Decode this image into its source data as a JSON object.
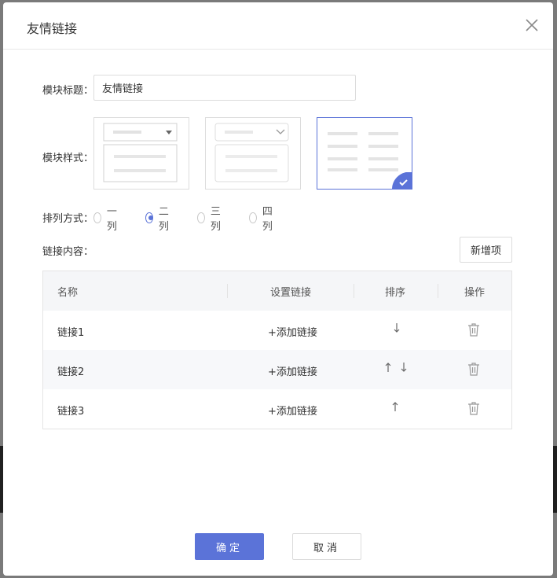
{
  "dialog": {
    "title": "友情链接",
    "close_icon": "close-icon"
  },
  "form": {
    "title_label": "模块标题：",
    "title_value": "友情链接",
    "style_label": "模块样式：",
    "style_options": [
      {
        "name": "dropdown-expanded-style",
        "selected": false
      },
      {
        "name": "dropdown-collapsed-style",
        "selected": false
      },
      {
        "name": "two-column-list-style",
        "selected": true
      }
    ],
    "layout_label": "排列方式：",
    "layout_options": [
      {
        "label": "一列",
        "checked": false
      },
      {
        "label": "二列",
        "checked": true
      },
      {
        "label": "三列",
        "checked": false
      },
      {
        "label": "四列",
        "checked": false
      }
    ],
    "links_label": "链接内容：",
    "add_item_label": "新增项"
  },
  "table": {
    "columns": [
      "名称",
      "设置链接",
      "排序",
      "操作"
    ],
    "rows": [
      {
        "name": "链接1",
        "link": "+添加链接",
        "up": false,
        "down": true
      },
      {
        "name": "链接2",
        "link": "+添加链接",
        "up": true,
        "down": true
      },
      {
        "name": "链接3",
        "link": "+添加链接",
        "up": true,
        "down": false
      }
    ]
  },
  "footer": {
    "ok_label": "确定",
    "cancel_label": "取消"
  },
  "colors": {
    "accent": "#5b73d8",
    "border": "#dcdcdc",
    "row_alt": "#f7f8fa"
  }
}
